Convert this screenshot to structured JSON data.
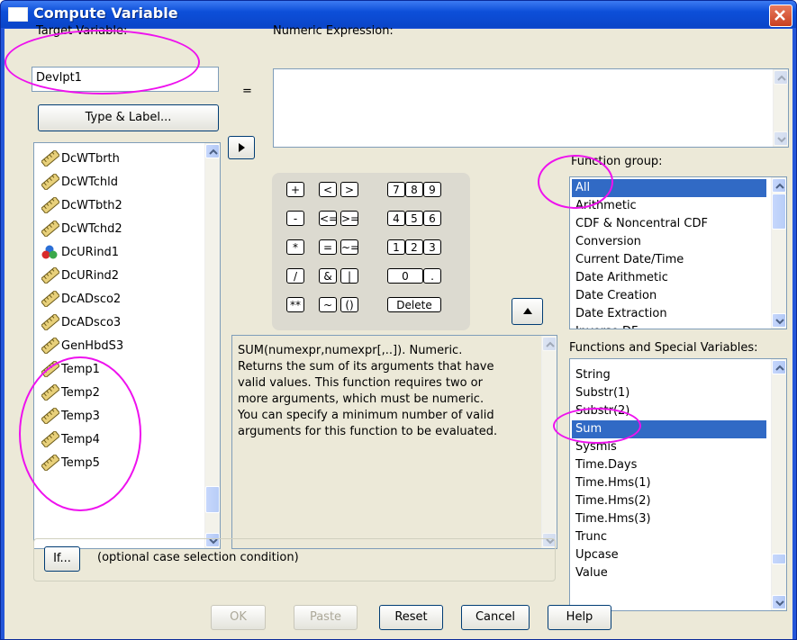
{
  "window": {
    "title": "Compute Variable"
  },
  "target": {
    "label": "Target Variable:",
    "value": "Devlpt1",
    "type_label_button": "Type & Label..."
  },
  "equals": "=",
  "expression": {
    "label": "Numeric Expression:",
    "value": ""
  },
  "variables": [
    {
      "name": "DcWTbrth",
      "icon": "ruler-icon"
    },
    {
      "name": "DcWTchld",
      "icon": "ruler-icon"
    },
    {
      "name": "DcWTbth2",
      "icon": "ruler-icon"
    },
    {
      "name": "DcWTchd2",
      "icon": "ruler-icon"
    },
    {
      "name": "DcURind1",
      "icon": "nominal-icon"
    },
    {
      "name": "DcURind2",
      "icon": "ruler-icon"
    },
    {
      "name": "DcADsco2",
      "icon": "ruler-icon"
    },
    {
      "name": "DcADsco3",
      "icon": "ruler-icon"
    },
    {
      "name": "GenHbdS3",
      "icon": "ruler-icon"
    },
    {
      "name": "Temp1",
      "icon": "ruler-icon"
    },
    {
      "name": "Temp2",
      "icon": "ruler-icon"
    },
    {
      "name": "Temp3",
      "icon": "ruler-icon"
    },
    {
      "name": "Temp4",
      "icon": "ruler-icon"
    },
    {
      "name": "Temp5",
      "icon": "ruler-icon"
    }
  ],
  "keypad": {
    "row1": [
      "+",
      "<",
      ">",
      "7",
      "8",
      "9"
    ],
    "row2": [
      "-",
      "<=",
      ">=",
      "4",
      "5",
      "6"
    ],
    "row3": [
      "*",
      "=",
      "~=",
      "1",
      "2",
      "3"
    ],
    "row4": [
      "/",
      "&",
      "|",
      "0",
      "."
    ],
    "row5": [
      "**",
      "~",
      "()",
      "Delete"
    ]
  },
  "function_group": {
    "label": "Function group:",
    "items": [
      "All",
      "Arithmetic",
      "CDF & Noncentral CDF",
      "Conversion",
      "Current Date/Time",
      "Date Arithmetic",
      "Date Creation",
      "Date Extraction",
      "Inverse DF"
    ],
    "selected": "All"
  },
  "description": "SUM(numexpr,numexpr[,..]). Numeric.\nReturns the sum of its arguments that have\nvalid values. This function requires two or\nmore arguments, which must be numeric.\nYou can specify a minimum number of valid\narguments for this function to be evaluated.",
  "functions": {
    "label": "Functions and Special Variables:",
    "items": [
      "String",
      "Substr(1)",
      "Substr(2)",
      "Sum",
      "Sysmis",
      "Time.Days",
      "Time.Hms(1)",
      "Time.Hms(2)",
      "Time.Hms(3)",
      "Trunc",
      "Upcase",
      "Value"
    ],
    "selected": "Sum"
  },
  "if": {
    "button": "If...",
    "text": "(optional case selection condition)"
  },
  "buttons": {
    "ok": "OK",
    "paste": "Paste",
    "reset": "Reset",
    "cancel": "Cancel",
    "help": "Help"
  },
  "colors": {
    "highlight_ellipse": "#ee11ee",
    "selection": "#316ac5",
    "titlebar": "#0d4fd9"
  }
}
